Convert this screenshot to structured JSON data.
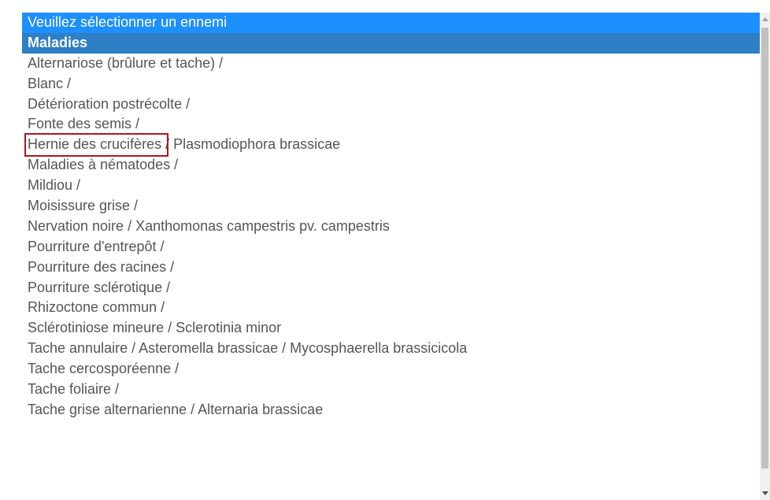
{
  "listbox": {
    "options": [
      {
        "label": "Veuillez sélectionner un ennemi",
        "kind": "placeholder-highlighted"
      },
      {
        "label": "Maladies",
        "kind": "group-header"
      },
      {
        "label": "Alternariose (brûlure et tache) /",
        "kind": "option"
      },
      {
        "label": "Blanc /",
        "kind": "option"
      },
      {
        "label": "Détérioration postrécolte /",
        "kind": "option"
      },
      {
        "label": "Fonte des semis /",
        "kind": "option",
        "marked": true
      },
      {
        "label": "Hernie des crucifères / Plasmodiophora brassicae",
        "kind": "option"
      },
      {
        "label": "Maladies à nématodes /",
        "kind": "option"
      },
      {
        "label": "Mildiou /",
        "kind": "option"
      },
      {
        "label": "Moisissure grise /",
        "kind": "option"
      },
      {
        "label": "Nervation noire / Xanthomonas campestris pv. campestris",
        "kind": "option"
      },
      {
        "label": "Pourriture d'entrepôt /",
        "kind": "option"
      },
      {
        "label": "Pourriture des racines /",
        "kind": "option"
      },
      {
        "label": "Pourriture sclérotique /",
        "kind": "option"
      },
      {
        "label": "Rhizoctone commun /",
        "kind": "option"
      },
      {
        "label": "Sclérotiniose mineure / Sclerotinia minor",
        "kind": "option"
      },
      {
        "label": "Tache annulaire / Asteromella brassicae / Mycosphaerella brassicicola",
        "kind": "option"
      },
      {
        "label": "Tache cercosporéenne /",
        "kind": "option"
      },
      {
        "label": "Tache foliaire /",
        "kind": "option"
      },
      {
        "label": "Tache grise alternarienne / Alternaria brassicae",
        "kind": "option"
      }
    ]
  },
  "colors": {
    "highlight": "#1e8fff",
    "group_header": "#2e7fc4",
    "option_text": "#555555",
    "marker_border": "#b5141f"
  },
  "icons": {
    "scroll_up": "triangle-up-icon",
    "scroll_down": "triangle-down-icon"
  }
}
